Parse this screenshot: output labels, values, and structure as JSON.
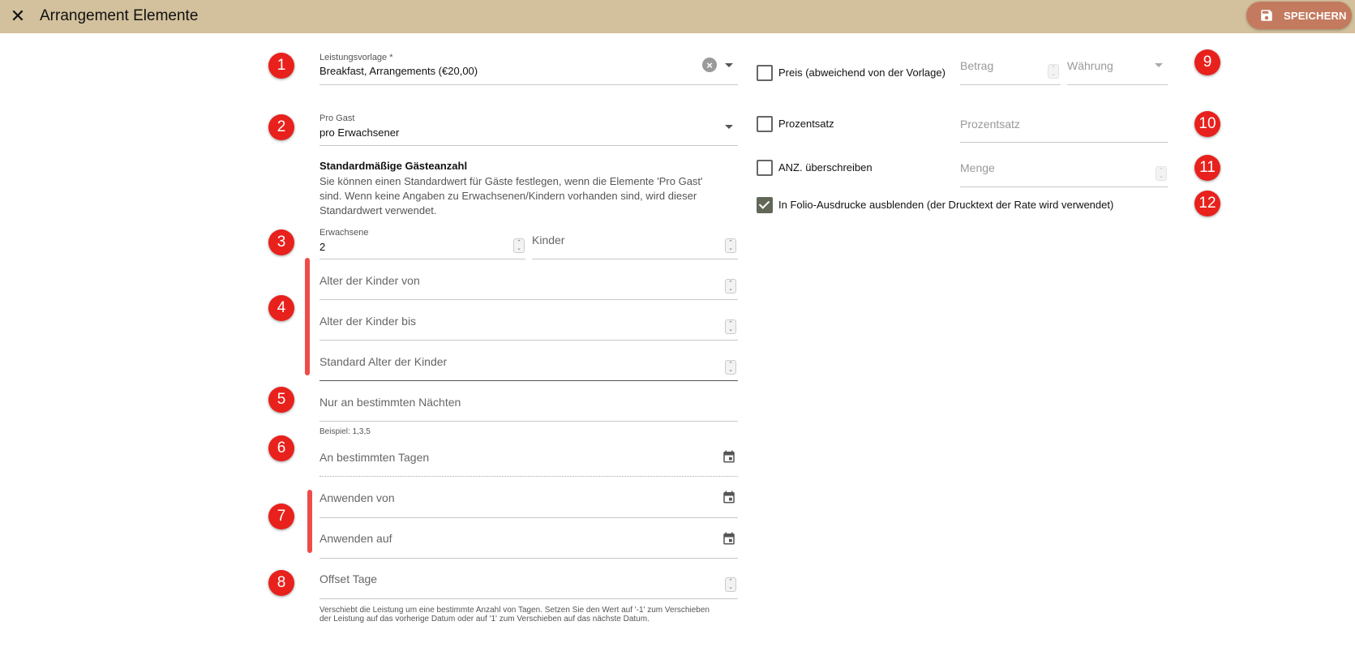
{
  "header": {
    "title": "Arrangement Elemente",
    "save_label": "SPEICHERN"
  },
  "badges": [
    "1",
    "2",
    "3",
    "4",
    "5",
    "6",
    "7",
    "8",
    "9",
    "10",
    "11",
    "12"
  ],
  "left": {
    "template": {
      "label": "Leistungsvorlage *",
      "value": "Breakfast, Arrangements (€20,00)"
    },
    "per_guest": {
      "label": "Pro Gast",
      "value": "pro Erwachsener"
    },
    "default_guests": {
      "title": "Standardmäßige Gästeanzahl",
      "description": "Sie können einen Standardwert für Gäste festlegen, wenn die Elemente 'Pro Gast' sind. Wenn keine Angaben zu Erwachsenen/Kindern vorhanden sind, wird dieser Standardwert verwendet."
    },
    "adults": {
      "label": "Erwachsene",
      "value": "2"
    },
    "children": {
      "placeholder": "Kinder"
    },
    "child_age_from": {
      "placeholder": "Alter der Kinder von"
    },
    "child_age_to": {
      "placeholder": "Alter der Kinder bis"
    },
    "child_age_default": {
      "placeholder": "Standard Alter der Kinder"
    },
    "nights": {
      "placeholder": "Nur an bestimmten Nächten",
      "hint": "Beispiel: 1,3,5"
    },
    "days": {
      "placeholder": "An bestimmten Tagen"
    },
    "apply_from": {
      "placeholder": "Anwenden von"
    },
    "apply_to": {
      "placeholder": "Anwenden auf"
    },
    "offset": {
      "placeholder": "Offset Tage",
      "hint_line1": "Verschiebt die Leistung um eine bestimmte Anzahl von Tagen. Setzen Sie den Wert auf '-1' zum Verschieben",
      "hint_line2": "der Leistung auf das vorherige Datum oder auf '1' zum Verschieben auf das nächste Datum."
    }
  },
  "right": {
    "price": {
      "label": "Preis (abweichend von der Vorlage)",
      "amount_placeholder": "Betrag",
      "currency_placeholder": "Währung",
      "checked": false
    },
    "percentage": {
      "label": "Prozentsatz",
      "placeholder": "Prozentsatz",
      "checked": false
    },
    "quantity": {
      "label": "ANZ. überschreiben",
      "placeholder": "Menge",
      "checked": false
    },
    "hide_folio": {
      "label": "In Folio-Ausdrucke ausblenden (der Drucktext der Rate wird verwendet)",
      "checked": true
    }
  },
  "colors": {
    "header_bg": "#d2c19c",
    "save_button": "#c47a5e",
    "badge": "#e8211d",
    "accent_bar": "#ef4b4b",
    "checkbox_checked": "#616858"
  }
}
